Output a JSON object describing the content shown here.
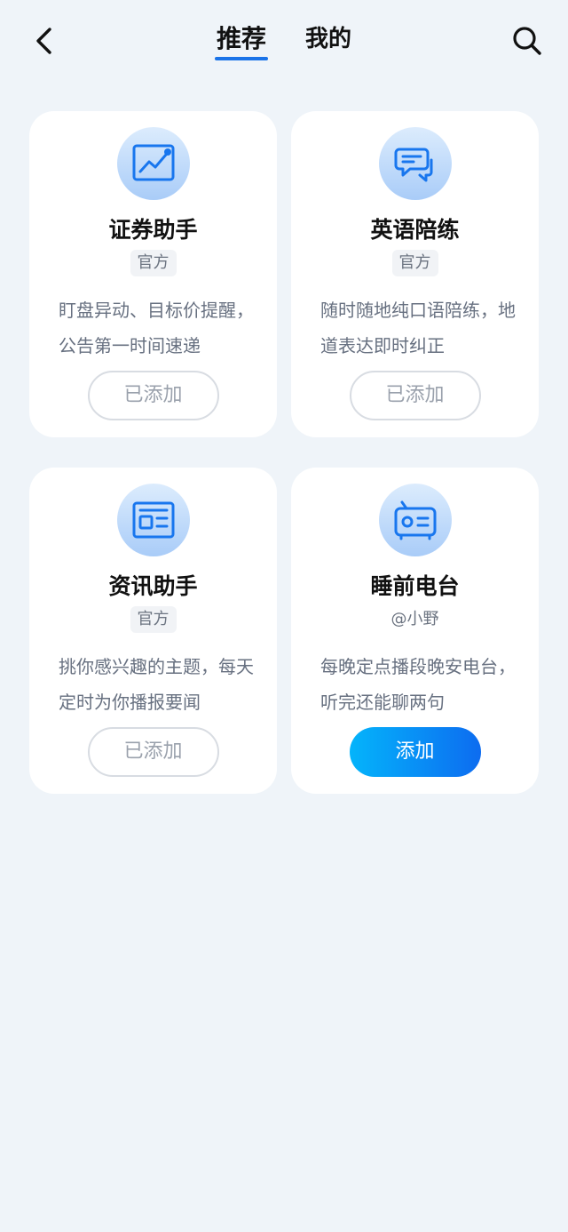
{
  "header": {
    "tabs": [
      {
        "label": "推荐",
        "active": true
      },
      {
        "label": "我的",
        "active": false
      }
    ]
  },
  "colors": {
    "accent": "#1a73e8",
    "icon_stroke": "#1876ee",
    "page_bg": "#eff4f9",
    "add_gradient_start": "#04b4fb",
    "add_gradient_end": "#0d6cf0"
  },
  "cards": [
    {
      "icon": "trend-chart-icon",
      "title": "证券助手",
      "tag": "官方",
      "desc": "盯盘异动、目标价提醒，公告第一时间速递",
      "button": "已添加",
      "added": true
    },
    {
      "icon": "chat-bubbles-icon",
      "title": "英语陪练",
      "tag": "官方",
      "desc": "随时随地纯口语陪练，地道表达即时纠正",
      "button": "已添加",
      "added": true
    },
    {
      "icon": "newspaper-icon",
      "title": "资讯助手",
      "tag": "官方",
      "desc": "挑你感兴趣的主题，每天定时为你播报要闻",
      "button": "已添加",
      "added": true
    },
    {
      "icon": "radio-icon",
      "title": "睡前电台",
      "tag": "@小野",
      "desc": "每晚定点播段晚安电台，听完还能聊两句",
      "button": "添加",
      "added": false
    }
  ]
}
